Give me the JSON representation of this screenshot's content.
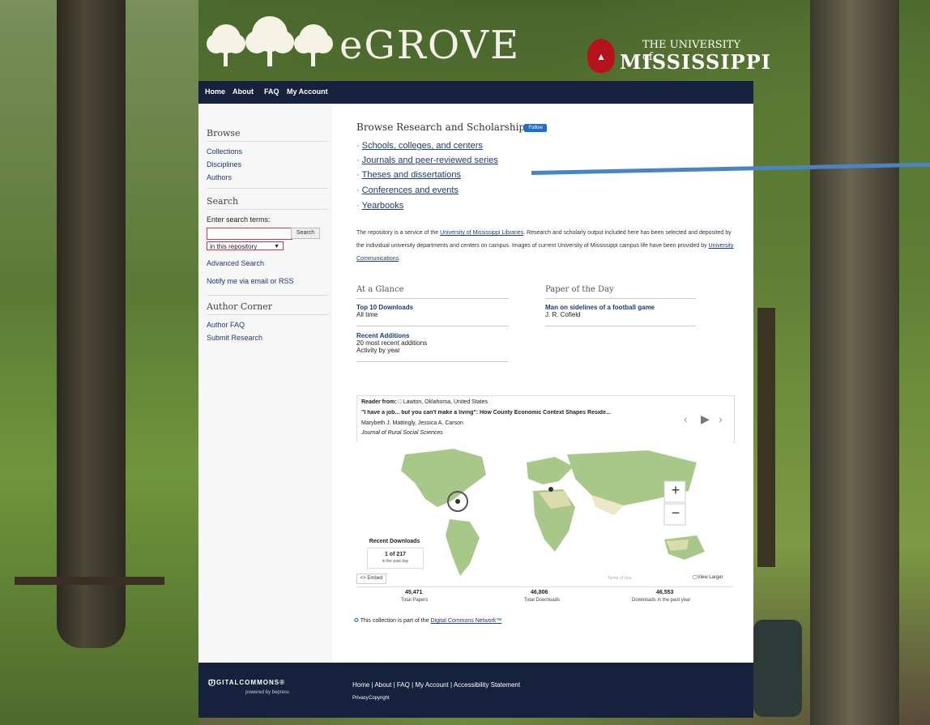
{
  "header": {
    "logo_text": "eGROVE",
    "university_small": "THE UNIVERSITY of",
    "university_big": "MISSISSIPPI"
  },
  "topnav": [
    "Home",
    "About",
    "FAQ",
    "My Account"
  ],
  "sidebar": {
    "browse_heading": "Browse",
    "browse_links": [
      "Collections",
      "Disciplines",
      "Authors"
    ],
    "search_heading": "Search",
    "search_label": "Enter search terms:",
    "search_button": "Search",
    "search_scope": "in this repository",
    "advanced_search": "Advanced Search",
    "notify": "Notify me via email or RSS",
    "author_heading": "Author Corner",
    "author_links": [
      "Author FAQ",
      "Submit Research"
    ]
  },
  "main": {
    "title": "Browse Research and Scholarship",
    "follow": "Follow",
    "links": [
      "Schools, colleges, and centers",
      "Journals and peer-reviewed series",
      "Theses and dissertations",
      "Conferences and events",
      "Yearbooks"
    ],
    "description_1": "The repository is a service of the ",
    "description_link1": "University of Mississippi Libraries",
    "description_2": ". Research and scholarly output included here has been selected and deposited by the individual university departments and centers on campus. Images of current University of Mississippi campus life have been provided by ",
    "description_link2": "University Communications",
    "description_3": "."
  },
  "glance": {
    "heading": "At a Glance",
    "top_title": "Top 10 Downloads",
    "top_sub": "All time",
    "recent_title": "Recent Additions",
    "recent_sub1": "20 most recent additions",
    "recent_sub2": "Activity by year"
  },
  "paper_of_day": {
    "heading": "Paper of the Day",
    "title": "Man on sidelines of a football game",
    "author": "J. R. Cofield"
  },
  "reader": {
    "from_label": "Reader from:",
    "location": "Lawton, Oklahoma, United States",
    "title": "\"I have a job... but you can't make a living\": How County Economic Context Shapes Reside...",
    "authors": "Marybeth J. Mattingly, Jessica A. Carson",
    "journal": "Journal of Rural Social Sciences"
  },
  "map": {
    "recent_downloads": "Recent Downloads",
    "count": "1 of 217",
    "count_sub": "in the past day",
    "embed": "<> Embed",
    "view_larger": "View Larger",
    "zoom_in": "+",
    "zoom_out": "−",
    "terms": "Terms of Use",
    "stats": [
      {
        "value": "45,471",
        "label": "Total Papers"
      },
      {
        "value": "46,806",
        "label": "Total Downloads"
      },
      {
        "value": "46,553",
        "label": "Downloads in the past year"
      }
    ]
  },
  "dc_network": {
    "text": "This collection is part of the ",
    "link": "Digital Commons Network™"
  },
  "footer": {
    "brand": "DIGITALCOMMONS®",
    "brand_sub": "powered by bepress",
    "links": "Home  |  About  |  FAQ  |  My Account  |  Accessibility Statement",
    "privacy": "Privacy",
    "copyright": "Copyright"
  },
  "colors": {
    "nav_bg": "#16213e",
    "link": "#1a3b7d",
    "follow": "#1f6fd1",
    "um_red": "#b5121b",
    "arrow": "#4a84c4"
  }
}
